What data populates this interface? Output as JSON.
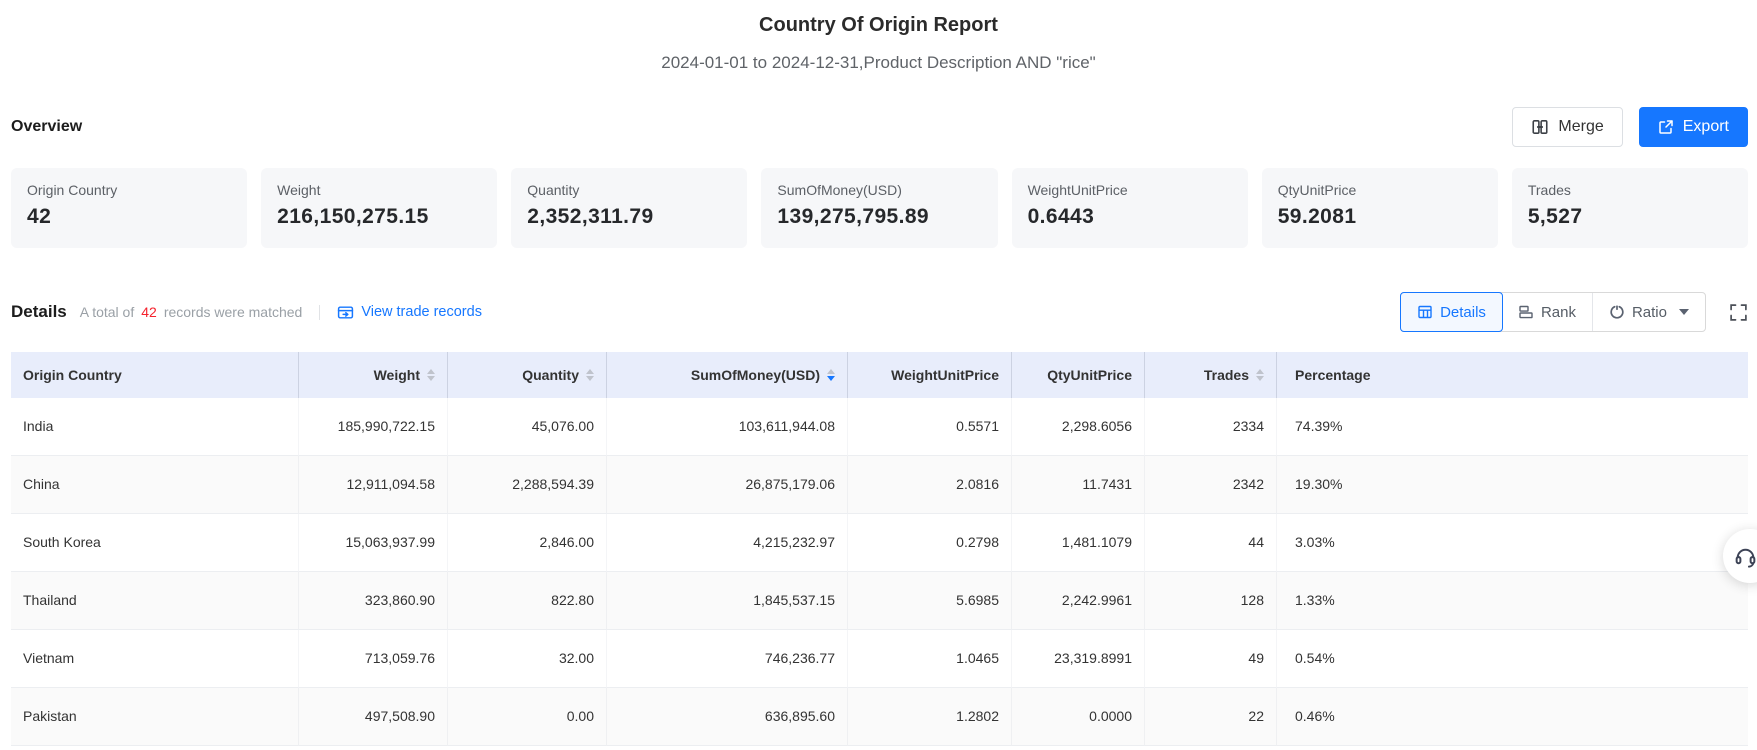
{
  "report": {
    "title": "Country Of Origin Report",
    "subtitle": "2024-01-01 to 2024-12-31,Product Description AND \"rice\""
  },
  "overview": {
    "heading": "Overview",
    "merge_label": "Merge",
    "export_label": "Export",
    "cards": [
      {
        "label": "Origin Country",
        "value": "42"
      },
      {
        "label": "Weight",
        "value": "216,150,275.15"
      },
      {
        "label": "Quantity",
        "value": "2,352,311.79"
      },
      {
        "label": "SumOfMoney(USD)",
        "value": "139,275,795.89"
      },
      {
        "label": "WeightUnitPrice",
        "value": "0.6443"
      },
      {
        "label": "QtyUnitPrice",
        "value": "59.2081"
      },
      {
        "label": "Trades",
        "value": "5,527"
      }
    ]
  },
  "details": {
    "heading": "Details",
    "match_prefix": "A total of",
    "match_count": "42",
    "match_suffix": "records were matched",
    "view_link": "View trade records",
    "tabs": [
      {
        "label": "Details",
        "icon": "table-icon",
        "active": true
      },
      {
        "label": "Rank",
        "icon": "rank-icon",
        "active": false
      },
      {
        "label": "Ratio",
        "icon": "ratio-icon",
        "active": false,
        "dropdown": true
      }
    ]
  },
  "table": {
    "columns": [
      {
        "label": "Origin Country",
        "sortable": false
      },
      {
        "label": "Weight",
        "sortable": true
      },
      {
        "label": "Quantity",
        "sortable": true
      },
      {
        "label": "SumOfMoney(USD)",
        "sortable": true,
        "sort": "desc"
      },
      {
        "label": "WeightUnitPrice",
        "sortable": false
      },
      {
        "label": "QtyUnitPrice",
        "sortable": false
      },
      {
        "label": "Trades",
        "sortable": true
      },
      {
        "label": "Percentage",
        "sortable": false
      }
    ],
    "rows": [
      [
        "India",
        "185,990,722.15",
        "45,076.00",
        "103,611,944.08",
        "0.5571",
        "2,298.6056",
        "2334",
        "74.39%"
      ],
      [
        "China",
        "12,911,094.58",
        "2,288,594.39",
        "26,875,179.06",
        "2.0816",
        "11.7431",
        "2342",
        "19.30%"
      ],
      [
        "South Korea",
        "15,063,937.99",
        "2,846.00",
        "4,215,232.97",
        "0.2798",
        "1,481.1079",
        "44",
        "3.03%"
      ],
      [
        "Thailand",
        "323,860.90",
        "822.80",
        "1,845,537.15",
        "5.6985",
        "2,242.9961",
        "128",
        "1.33%"
      ],
      [
        "Vietnam",
        "713,059.76",
        "32.00",
        "746,236.77",
        "1.0465",
        "23,319.8991",
        "49",
        "0.54%"
      ],
      [
        "Pakistan",
        "497,508.90",
        "0.00",
        "636,895.60",
        "1.2802",
        "0.0000",
        "22",
        "0.46%"
      ]
    ]
  },
  "colors": {
    "accent_blue": "#1677ff",
    "count_red": "#f5222d",
    "table_header_bg": "#e8edfb",
    "row_stripe_bg": "#fafafa",
    "card_bg": "#f6f7f9"
  }
}
